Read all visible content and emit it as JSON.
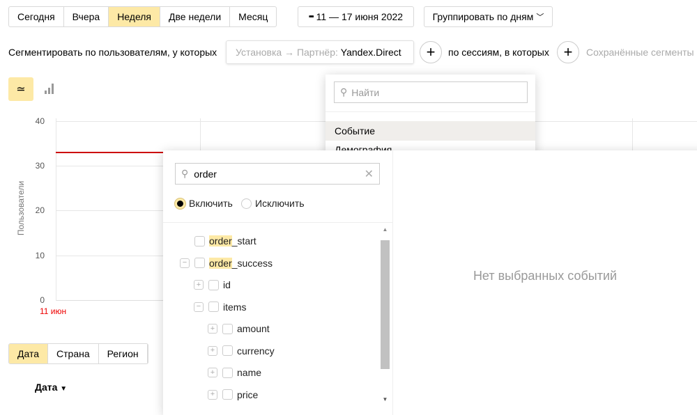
{
  "period": {
    "options": [
      "Сегодня",
      "Вчера",
      "Неделя",
      "Две недели",
      "Месяц"
    ],
    "selected": "Неделя"
  },
  "date_range": "11 — 17 июня 2022",
  "group_by": "Группировать по дням",
  "segment": {
    "label": "Сегментировать по пользователям, у которых",
    "condition_key": "Установка → Партнёр:",
    "condition_value": "Yandex.Direct",
    "sessions_label": "по сессиям, в которых",
    "saved": "Сохранённые сегменты"
  },
  "chart_types": [
    "line-chart-icon",
    "bar-chart-icon"
  ],
  "chart_data": {
    "type": "line",
    "ylabel": "Пользователи",
    "yticks": [
      "40",
      "30",
      "20",
      "10",
      "0"
    ],
    "ylim": [
      0,
      40
    ],
    "xticks": [
      "11 июн"
    ],
    "series": [
      {
        "values": [
          33
        ],
        "color": "#cc0000"
      }
    ]
  },
  "tabs": [
    "Дата",
    "Страна",
    "Регион"
  ],
  "table": {
    "column": "Дата"
  },
  "menu": {
    "search_placeholder": "Найти",
    "items": [
      "Событие",
      "Демография"
    ]
  },
  "events": {
    "search_value": "order",
    "include": "Включить",
    "exclude": "Исключить",
    "empty": "Нет выбранных событий",
    "highlight": "order",
    "items": [
      {
        "label": "order_start",
        "level": 0,
        "toggle": ""
      },
      {
        "label": "order_success",
        "level": 0,
        "toggle": "−"
      },
      {
        "label": "id",
        "level": 1,
        "toggle": "+"
      },
      {
        "label": "items",
        "level": 1,
        "toggle": "−"
      },
      {
        "label": "amount",
        "level": 2,
        "toggle": "+"
      },
      {
        "label": "currency",
        "level": 2,
        "toggle": "+"
      },
      {
        "label": "name",
        "level": 2,
        "toggle": "+"
      },
      {
        "label": "price",
        "level": 2,
        "toggle": "+"
      }
    ]
  }
}
